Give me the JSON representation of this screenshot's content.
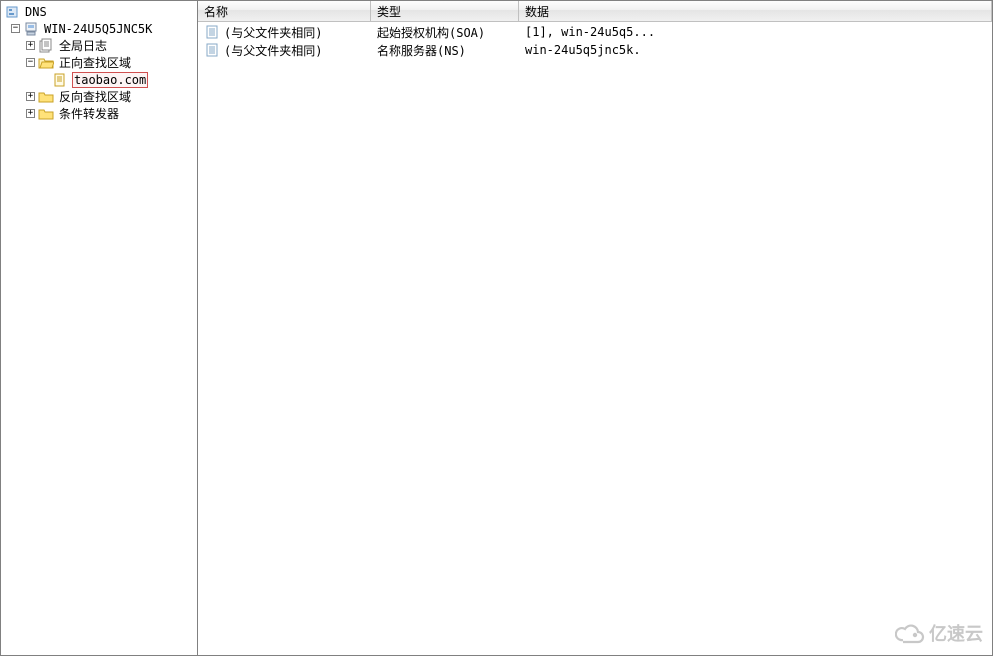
{
  "tree": {
    "root": "DNS",
    "server": "WIN-24U5Q5JNC5K",
    "items": {
      "global_log": "全局日志",
      "forward_zone": "正向查找区域",
      "zone_taobao": "taobao.com",
      "reverse_zone": "反向查找区域",
      "cond_forwarders": "条件转发器"
    }
  },
  "columns": {
    "name": "名称",
    "type": "类型",
    "data": "数据"
  },
  "col_widths": {
    "name": 173,
    "type": 148,
    "data": 471
  },
  "rows": [
    {
      "name": "(与父文件夹相同)",
      "type": "起始授权机构(SOA)",
      "data": "[1], win-24u5q5..."
    },
    {
      "name": "(与父文件夹相同)",
      "type": "名称服务器(NS)",
      "data": "win-24u5q5jnc5k."
    }
  ],
  "watermark": "亿速云"
}
